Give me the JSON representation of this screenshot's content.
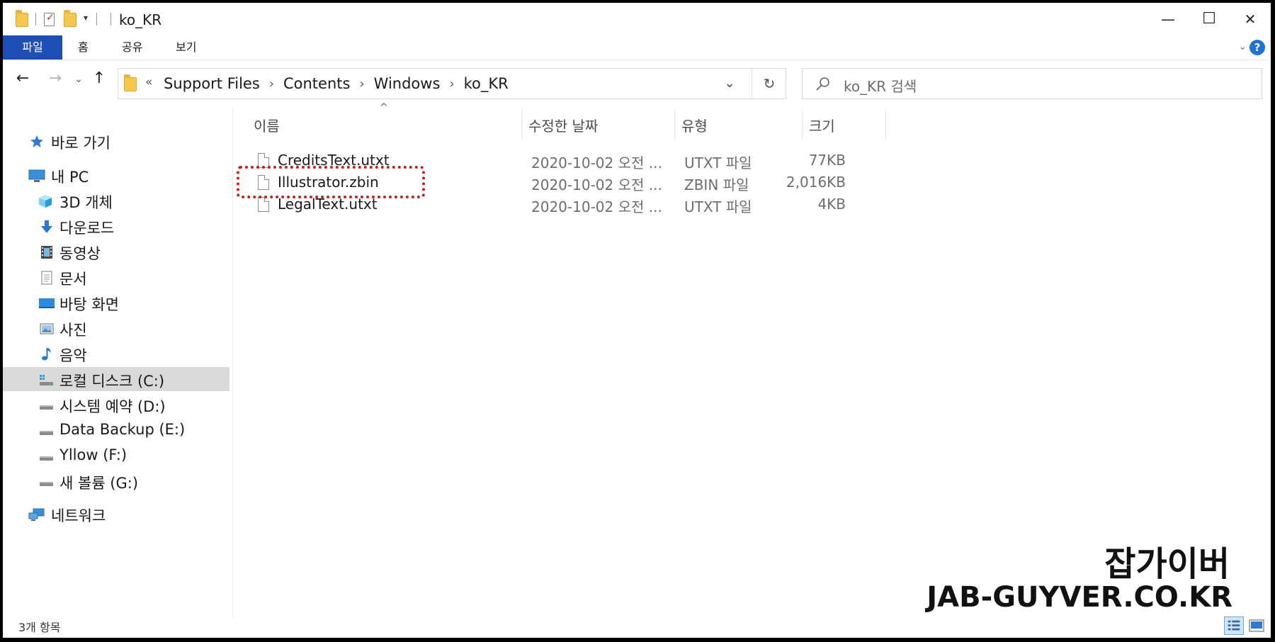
{
  "window": {
    "title": "ko_KR",
    "minimize_glyph": "—",
    "maximize_glyph": "☐",
    "close_glyph": "✕"
  },
  "quick_access": {
    "dropdown_glyph": "▾"
  },
  "ribbon": {
    "tabs": [
      "파일",
      "홈",
      "공유",
      "보기"
    ],
    "chevron_glyph": "⌄",
    "help_glyph": "?"
  },
  "nav": {
    "back_glyph": "←",
    "forward_glyph": "→",
    "recent_glyph": "⌄",
    "up_glyph": "↑"
  },
  "address": {
    "prefix": "«",
    "breadcrumbs": [
      "Support Files",
      "Contents",
      "Windows",
      "ko_KR"
    ],
    "separator": "›",
    "dropdown_glyph": "⌄",
    "refresh_glyph": "↻"
  },
  "search": {
    "placeholder": "ko_KR 검색"
  },
  "sidebar": {
    "items": [
      {
        "label": "바로 가기",
        "icon": "star-icon"
      },
      {
        "label": "내 PC",
        "icon": "computer-icon"
      },
      {
        "label": "3D 개체",
        "icon": "cube-3d-icon"
      },
      {
        "label": "다운로드",
        "icon": "download-arrow-icon"
      },
      {
        "label": "동영상",
        "icon": "video-film-icon"
      },
      {
        "label": "문서",
        "icon": "document-icon"
      },
      {
        "label": "바탕 화면",
        "icon": "desktop-icon"
      },
      {
        "label": "사진",
        "icon": "pictures-icon"
      },
      {
        "label": "음악",
        "icon": "music-note-icon"
      },
      {
        "label": "로컬 디스크 (C:)",
        "icon": "windows-drive-icon",
        "selected": true
      },
      {
        "label": "시스템 예약 (D:)",
        "icon": "drive-icon"
      },
      {
        "label": "Data Backup (E:)",
        "icon": "drive-icon"
      },
      {
        "label": "Yllow (F:)",
        "icon": "drive-icon"
      },
      {
        "label": "새 볼륨 (G:)",
        "icon": "drive-icon"
      },
      {
        "label": "네트워크",
        "icon": "network-icon"
      }
    ]
  },
  "content": {
    "columns": [
      "이름",
      "수정한 날짜",
      "유형",
      "크기"
    ],
    "sort_glyph": "^",
    "files": [
      {
        "name": "CreditsText.utxt",
        "date": "2020-10-02 오전 ...",
        "type": "UTXT 파일",
        "size": "77KB"
      },
      {
        "name": "Illustrator.zbin",
        "date": "2020-10-02 오전 ...",
        "type": "ZBIN 파일",
        "size": "2,016KB",
        "highlighted": true
      },
      {
        "name": "LegalText.utxt",
        "date": "2020-10-02 오전 ...",
        "type": "UTXT 파일",
        "size": "4KB"
      }
    ]
  },
  "status": {
    "item_count": "3개 항목"
  },
  "watermark": {
    "korean": "잡가이버",
    "site": "JAB-GUYVER.CO.KR"
  },
  "colors": {
    "file_tab": "#1f4eb4",
    "selected_nav": "#d9d9d9",
    "highlight_box": "#c02020",
    "folder": "#f5c94e"
  }
}
